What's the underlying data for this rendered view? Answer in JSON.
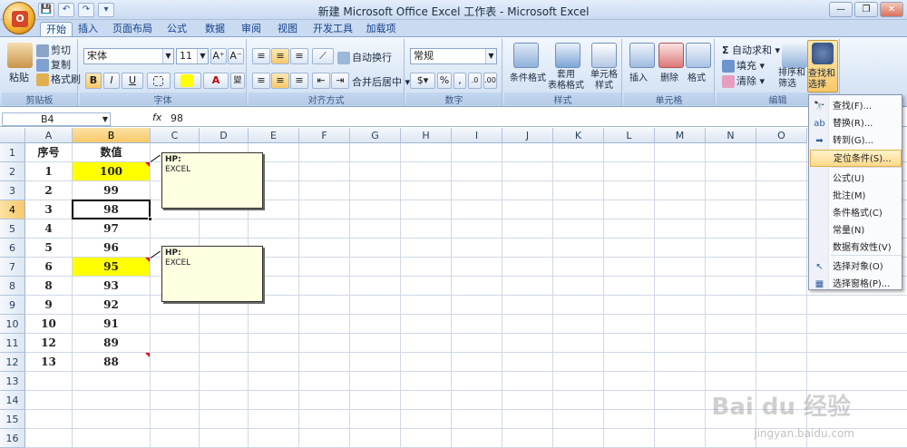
{
  "window": {
    "title": "新建 Microsoft Office Excel 工作表 - Microsoft Excel",
    "office_button": "O",
    "qat": [
      "💾",
      "↶",
      "↷",
      "▾"
    ],
    "controls": [
      "—",
      "❐",
      "✕"
    ]
  },
  "tabs": [
    "开始",
    "插入",
    "页面布局",
    "公式",
    "数据",
    "审阅",
    "视图",
    "开发工具",
    "加载项"
  ],
  "active_tab": "开始",
  "ribbon": {
    "clipboard": {
      "paste": "粘贴",
      "cut": "剪切",
      "copy": "复制",
      "format_painter": "格式刷",
      "label": "剪贴板"
    },
    "font": {
      "name": "宋体",
      "size": "11",
      "grow": "A⁺",
      "shrink": "A⁻",
      "bold": "B",
      "italic": "I",
      "underline": "U",
      "label": "字体",
      "phonetic": "變"
    },
    "alignment": {
      "wrap": "自动换行",
      "merge": "合并后居中",
      "label": "对齐方式"
    },
    "number": {
      "format": "常规",
      "percent": "%",
      "comma": ",",
      "label": "数字"
    },
    "styles": {
      "conditional": "条件格式",
      "table": "套用\n表格格式",
      "cell": "单元格\n样式",
      "label": "样式"
    },
    "cells": {
      "insert": "插入",
      "delete": "删除",
      "format": "格式",
      "label": "单元格"
    },
    "editing": {
      "autosum": "自动求和",
      "fill": "填充",
      "clear": "清除",
      "sort": "排序和\n筛选",
      "find": "查找和\n选择",
      "label": "编辑"
    }
  },
  "formula_bar": {
    "name_box": "B4",
    "fx": "fx",
    "value": "98"
  },
  "columns": [
    "A",
    "B",
    "C",
    "D",
    "E",
    "F",
    "G",
    "H",
    "I",
    "J",
    "K",
    "L",
    "M",
    "N",
    "O"
  ],
  "selected_column": "B",
  "rows": [
    "1",
    "2",
    "3",
    "4",
    "5",
    "6",
    "7",
    "8",
    "9",
    "10",
    "11",
    "12",
    "13",
    "14",
    "15",
    "16"
  ],
  "selected_row": "4",
  "header": {
    "a": "序号",
    "b": "数值"
  },
  "table": [
    {
      "a": "1",
      "b": "100"
    },
    {
      "a": "2",
      "b": "99"
    },
    {
      "a": "3",
      "b": "98"
    },
    {
      "a": "4",
      "b": "97"
    },
    {
      "a": "5",
      "b": "96"
    },
    {
      "a": "6",
      "b": "95"
    },
    {
      "a": "8",
      "b": "93"
    },
    {
      "a": "9",
      "b": "92"
    },
    {
      "a": "10",
      "b": "91"
    },
    {
      "a": "12",
      "b": "89"
    },
    {
      "a": "13",
      "b": "88"
    }
  ],
  "comments": [
    {
      "author": "HP:",
      "text": "EXCEL"
    },
    {
      "author": "HP:",
      "text": "EXCEL"
    }
  ],
  "menu": [
    {
      "label": "查找(F)...",
      "icon": "🔭"
    },
    {
      "label": "替换(R)...",
      "icon": "ab"
    },
    {
      "label": "转到(G)...",
      "icon": "➡"
    },
    {
      "label": "定位条件(S)...",
      "icon": ""
    },
    {
      "label": "公式(U)",
      "icon": ""
    },
    {
      "label": "批注(M)",
      "icon": ""
    },
    {
      "label": "条件格式(C)",
      "icon": ""
    },
    {
      "label": "常量(N)",
      "icon": ""
    },
    {
      "label": "数据有效性(V)",
      "icon": ""
    },
    {
      "label": "选择对象(O)",
      "icon": "↖"
    },
    {
      "label": "选择窗格(P)...",
      "icon": "▦"
    }
  ],
  "watermark": {
    "brand": "Bai du 经验",
    "url": "jingyan.baidu.com"
  },
  "colors": {
    "highlight": "#ffff00",
    "comment_bg": "#ffffe1",
    "selected_header": "#f8c86a"
  }
}
